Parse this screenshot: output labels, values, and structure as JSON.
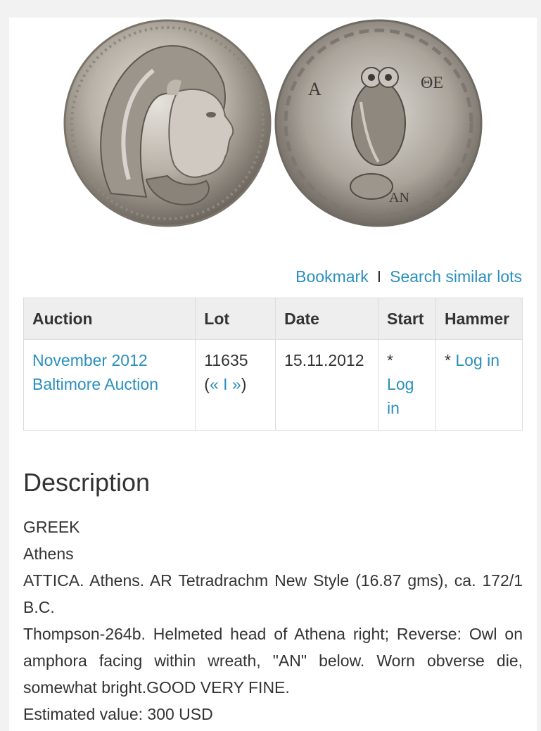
{
  "links": {
    "bookmark": "Bookmark",
    "separator": "I",
    "search_similar": "Search similar lots"
  },
  "table": {
    "headers": [
      "Auction",
      "Lot",
      "Date",
      "Start",
      "Hammer"
    ],
    "row": {
      "auction_line1": "November 2012",
      "auction_line2": "Baltimore Auction",
      "lot_number": "11635",
      "lot_nav_open": "(",
      "lot_prev": "«",
      "lot_nav_sep": "I",
      "lot_next": "»",
      "lot_nav_close": ")",
      "date": "15.11.2012",
      "start_star": "*",
      "start_login": "Log in",
      "hammer_star": "*",
      "hammer_login": "Log in"
    }
  },
  "description": {
    "title": "Description",
    "lines": [
      "GREEK",
      "Athens",
      "ATTICA. Athens. AR Tetradrachm New Style (16.87 gms), ca. 172/1 B.C.",
      "Thompson-264b. Helmeted head of Athena right; Reverse: Owl on amphora facing within wreath, \"AN\" below. Worn obverse die, somewhat bright.GOOD VERY FINE.",
      "Estimated value: 300 USD"
    ]
  },
  "coin": {
    "reverse_letters": [
      "A",
      "ΘΕ",
      "AN"
    ]
  }
}
